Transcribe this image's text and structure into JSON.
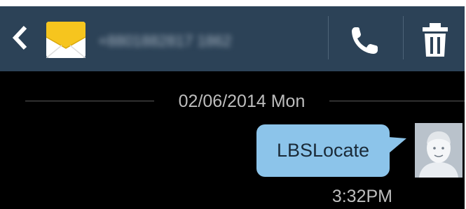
{
  "header": {
    "contact_name": "+8801882817 1862",
    "colors": {
      "bar_background": "#2c4257",
      "envelope_yellow": "#f6c51e",
      "icon_white": "#ffffff"
    },
    "icons": {
      "back": "chevron-left-icon",
      "message": "envelope-icon",
      "call": "phone-icon",
      "delete": "trash-icon"
    }
  },
  "conversation": {
    "date_label": "02/06/2014 Mon",
    "messages": [
      {
        "text": "LBSLocate",
        "time": "3:32PM",
        "direction": "outgoing",
        "bubble_color": "#8cc4ea",
        "avatar": "default-contact-avatar"
      }
    ]
  }
}
